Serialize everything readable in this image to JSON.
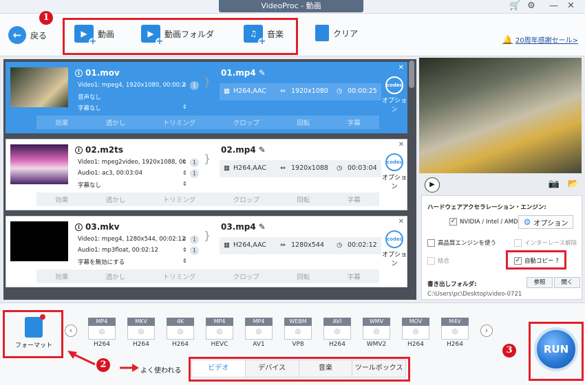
{
  "window": {
    "title": "VideoProc - 動画"
  },
  "toolbar": {
    "back_label": "戻る",
    "video_label": "動画",
    "folder_label": "動画フォルダ",
    "music_label": "音楽",
    "clear_label": "クリア",
    "promo_label": "20周年感謝セール>"
  },
  "badges": {
    "one": "1",
    "two": "2",
    "three": "3"
  },
  "files": [
    {
      "name": "01.mov",
      "video": "Video1: mpeg4, 1920x1080, 00:00:25",
      "audio": "音声なし",
      "subtitle": "字幕なし",
      "count": "1",
      "out_name": "01.mp4",
      "codec": "H264,AAC",
      "resolution": "1920x1080",
      "duration": "00:00:25"
    },
    {
      "name": "02.m2ts",
      "video": "Video1: mpeg2video, 1920x1088, 00:...",
      "audio": "Audio1: ac3, 00:03:04",
      "subtitle": "字幕なし",
      "count": "1",
      "count2": "1",
      "out_name": "02.mp4",
      "codec": "H264,AAC",
      "resolution": "1920x1088",
      "duration": "00:03:04"
    },
    {
      "name": "03.mkv",
      "video": "Video1: mpeg4, 1280x544, 00:02:12",
      "audio": "Audio1: mp3float, 00:02:12",
      "subtitle": "字幕を無効にする",
      "count": "1",
      "count2": "1",
      "out_name": "03.mp4",
      "codec": "H264,AAC",
      "resolution": "1280x544",
      "duration": "00:02:12"
    }
  ],
  "edit_actions": {
    "effect": "効果",
    "watermark": "透かし",
    "trim": "トリミング",
    "crop": "クロップ",
    "rotate": "回転",
    "subtitle": "字幕"
  },
  "codec_option": "オプション",
  "settings": {
    "hw_title": "ハードウェアアクセラレーション・エンジン:",
    "hw_check": "NVIDIA / Intel / AMD",
    "option_btn": "オプション",
    "hq_engine": "高品質エンジンを使う",
    "deinterlace": "インターレース解除",
    "merge": "結合",
    "auto_copy": "自動コピー ?",
    "output_folder_label": "書き出しフォルダ:",
    "browse": "参照",
    "open": "開く",
    "output_path": "C:\\Users\\pc\\Desktop\\video-0721"
  },
  "format_btn": "フォーマット",
  "presets": [
    {
      "top": "MP4",
      "label": "H264"
    },
    {
      "top": "MKV",
      "label": "H264"
    },
    {
      "top": "4K",
      "label": "H264"
    },
    {
      "top": "MP4",
      "label": "HEVC"
    },
    {
      "top": "MP4",
      "label": "AV1"
    },
    {
      "top": "WEBM",
      "label": "VP8"
    },
    {
      "top": "AVI",
      "label": "H264"
    },
    {
      "top": "WMV",
      "label": "WMV2"
    },
    {
      "top": "MOV",
      "label": "H264"
    },
    {
      "top": "M4V",
      "label": "H264"
    }
  ],
  "common_label": "よく使われる",
  "tabs": [
    "ビデオ",
    "デバイス",
    "音楽",
    "ツールボックス"
  ],
  "run_label": "RUN"
}
